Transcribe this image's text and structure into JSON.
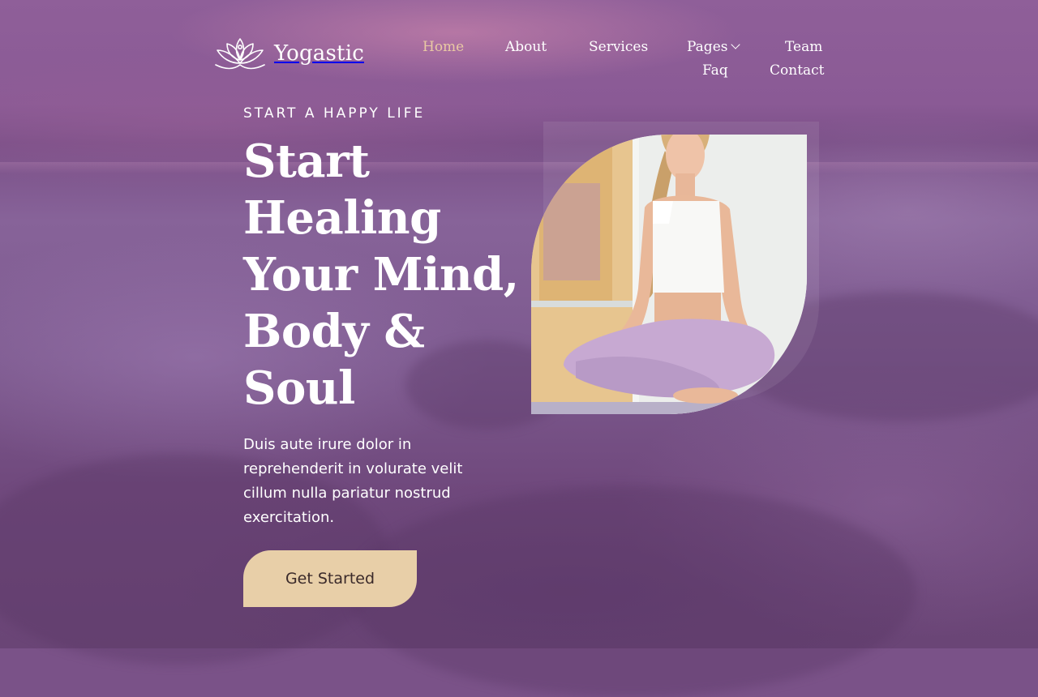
{
  "brand": {
    "name": "Yogastic",
    "icon": "lotus-icon"
  },
  "nav": {
    "items": [
      {
        "label": "Home",
        "active": true
      },
      {
        "label": "About",
        "active": false
      },
      {
        "label": "Services",
        "active": false
      },
      {
        "label": "Pages",
        "active": false,
        "icon": "chevron-down-icon"
      },
      {
        "label": "Team",
        "active": false
      },
      {
        "label": "Faq",
        "active": false
      },
      {
        "label": "Contact",
        "active": false
      }
    ]
  },
  "hero": {
    "kicker": "START A HAPPY LIFE",
    "headline": [
      "Start",
      "Healing",
      "Your Mind,",
      "Body &",
      "Soul"
    ],
    "description": "Duis aute irure dolor in reprehenderit in volurate velit cillum nulla pariatur nostrud exercitation.",
    "cta_label": "Get Started"
  },
  "colors": {
    "overlay": "#7a5288",
    "accent": "#e8cfa8",
    "nav_active": "#e9c9a3",
    "text": "#ffffff"
  }
}
